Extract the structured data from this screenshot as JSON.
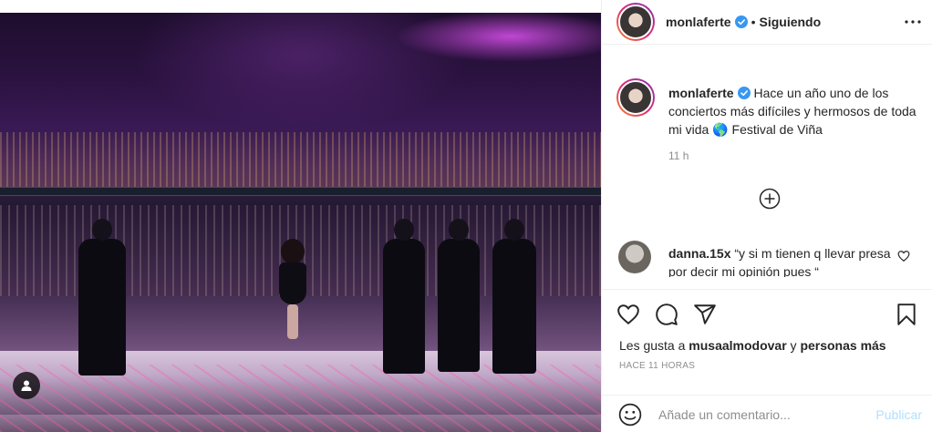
{
  "post": {
    "photo_alt": "",
    "profile_icon": "user-tag-icon"
  },
  "header": {
    "username": "monlaferte",
    "separator": "•",
    "follow_state": "Siguiendo",
    "more_icon": "more-horizontal-icon"
  },
  "caption": {
    "username": "monlaferte",
    "text": "Hace un año uno de los conciertos más difíciles y hermosos de toda mi vida 🌎 Festival de Viña",
    "time": "11 h"
  },
  "load_more_icon": "plus-circle-icon",
  "comments": [
    {
      "username": "danna.15x",
      "text": "“y si m tienen q llevar presa por decir mi opinión pues “"
    }
  ],
  "actions": {
    "like_icon": "heart-icon",
    "comment_icon": "comment-icon",
    "share_icon": "share-icon",
    "save_icon": "bookmark-icon"
  },
  "likes": {
    "prefix": "Les gusta a",
    "user": "musaalmodovar",
    "connector": "y",
    "others": "personas más"
  },
  "post_date": "HACE 11 HORAS",
  "comment_box": {
    "placeholder": "Añade un comentario...",
    "publish_label": "Publicar",
    "emoji_icon": "emoji-icon"
  },
  "colors": {
    "verified": "#3897f0",
    "publish_disabled": "#b2dffc",
    "muted_text": "#8e8e8e",
    "border": "#efefef"
  }
}
